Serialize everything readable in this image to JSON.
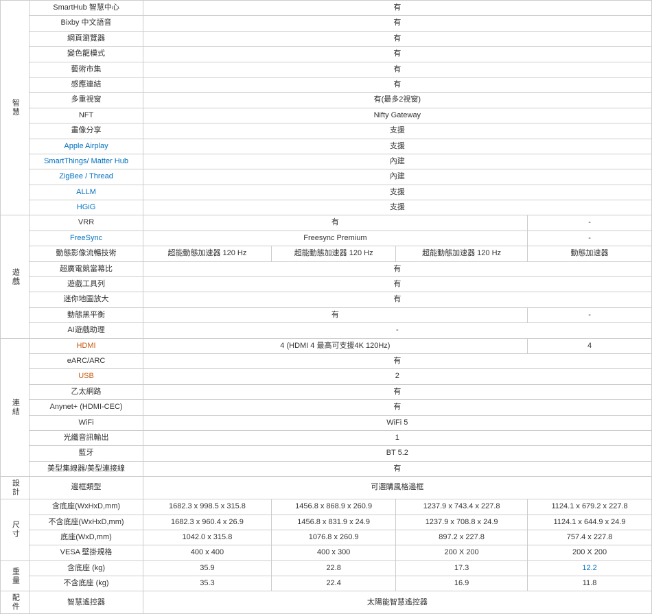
{
  "categories": {
    "smart": "智慧",
    "gaming": "遊戲",
    "connect": "連結",
    "design": "設計",
    "size": "尺寸",
    "weight": "重量",
    "accessory": "配件"
  },
  "rows": [
    {
      "cat": "智慧",
      "feature": "SmartHub 智慧中心",
      "values": [
        "有",
        "",
        "",
        ""
      ],
      "span": 4
    },
    {
      "cat": "",
      "feature": "Bixby 中文語音",
      "values": [
        "有",
        "",
        "",
        ""
      ],
      "span": 4
    },
    {
      "cat": "",
      "feature": "網頁瀏覽器",
      "values": [
        "有",
        "",
        "",
        ""
      ],
      "span": 4
    },
    {
      "cat": "",
      "feature": "變色龍模式",
      "values": [
        "有",
        "",
        "",
        ""
      ],
      "span": 4
    },
    {
      "cat": "",
      "feature": "藝術市集",
      "values": [
        "有",
        "",
        "",
        ""
      ],
      "span": 4
    },
    {
      "cat": "",
      "feature": "感應連結",
      "values": [
        "有",
        "",
        "",
        ""
      ],
      "span": 4
    },
    {
      "cat": "",
      "feature": "多重視窗",
      "values": [
        "有(最多2視窗)",
        "",
        "",
        ""
      ],
      "span": 4
    },
    {
      "cat": "",
      "feature": "NFT",
      "values": [
        "Nifty Gateway",
        "",
        "",
        ""
      ],
      "span": 4
    },
    {
      "cat": "",
      "feature": "畫像分享",
      "values": [
        "支援",
        "",
        "",
        ""
      ],
      "span": 4
    },
    {
      "cat": "",
      "feature": "Apple Airplay",
      "feature_color": "blue",
      "values": [
        "支援",
        "",
        "",
        ""
      ],
      "span": 4
    },
    {
      "cat": "",
      "feature": "SmartThings/ Matter Hub",
      "feature_color": "blue",
      "values": [
        "內建",
        "",
        "",
        ""
      ],
      "span": 4
    },
    {
      "cat": "",
      "feature": "ZigBee / Thread",
      "feature_color": "blue",
      "values": [
        "內建",
        "",
        "",
        ""
      ],
      "span": 4
    },
    {
      "cat": "",
      "feature": "ALLM",
      "feature_color": "blue",
      "values": [
        "支援",
        "",
        "",
        ""
      ],
      "span": 4
    },
    {
      "cat": "",
      "feature": "HGiG",
      "feature_color": "blue",
      "values": [
        "支援",
        "",
        "",
        ""
      ],
      "span": 4
    },
    {
      "cat": "遊戲",
      "feature": "VRR",
      "values": [
        "有",
        "",
        "",
        "-"
      ],
      "span_partial": true,
      "v1span": 3,
      "last": "-"
    },
    {
      "cat": "",
      "feature": "FreeSync",
      "feature_color": "blue",
      "values": [
        "Freesync Premium",
        "",
        "",
        "-"
      ],
      "span_partial": true,
      "v1span": 3,
      "last": "-"
    },
    {
      "cat": "",
      "feature": "動態影像流暢技術",
      "values": [
        "超能動態加速器 120 Hz",
        "超能動態加速器 120 Hz",
        "超能動態加速器 120 Hz",
        "動態加速器"
      ],
      "span": 0
    },
    {
      "cat": "",
      "feature": "超廣電競當幕比",
      "values": [
        "有",
        "",
        "",
        ""
      ],
      "span": 4
    },
    {
      "cat": "",
      "feature": "遊戲工具列",
      "values": [
        "有",
        "",
        "",
        ""
      ],
      "span": 4
    },
    {
      "cat": "",
      "feature": "迷你地圖放大",
      "values": [
        "有",
        "",
        "",
        ""
      ],
      "span": 4
    },
    {
      "cat": "",
      "feature": "動態黑平衡",
      "values": [
        "有",
        "",
        "",
        "-"
      ],
      "span_partial": true,
      "v1span": 3,
      "last": "-"
    },
    {
      "cat": "",
      "feature": "AI遊戲助理",
      "values": [
        "-",
        "",
        "",
        ""
      ],
      "span": 4
    },
    {
      "cat": "連結",
      "feature": "HDMI",
      "feature_color": "orange",
      "values": [
        "4 (HDMI 4 最高可支援4K 120Hz)",
        "",
        "",
        "4"
      ],
      "span_partial": true,
      "v1span": 3,
      "last": "4"
    },
    {
      "cat": "",
      "feature": "eARC/ARC",
      "values": [
        "有",
        "",
        "",
        ""
      ],
      "span": 4
    },
    {
      "cat": "",
      "feature": "USB",
      "feature_color": "orange",
      "values": [
        "2",
        "",
        "",
        ""
      ],
      "span": 4
    },
    {
      "cat": "",
      "feature": "乙太網路",
      "values": [
        "有",
        "",
        "",
        ""
      ],
      "span": 4
    },
    {
      "cat": "",
      "feature": "Anynet+ (HDMI-CEC)",
      "values": [
        "有",
        "",
        "",
        ""
      ],
      "span": 4
    },
    {
      "cat": "",
      "feature": "WiFi",
      "values": [
        "WiFi 5",
        "",
        "",
        ""
      ],
      "span": 4
    },
    {
      "cat": "",
      "feature": "光纖音訊輸出",
      "values": [
        "1",
        "",
        "",
        ""
      ],
      "span": 4
    },
    {
      "cat": "",
      "feature": "藍牙",
      "values": [
        "BT 5.2",
        "",
        "",
        ""
      ],
      "span": 4
    },
    {
      "cat": "",
      "feature": "美型集線器/美型連接線",
      "values": [
        "有",
        "",
        "",
        ""
      ],
      "span": 4
    },
    {
      "cat": "設計",
      "feature": "邊框類型",
      "values": [
        "可選購風格邊框",
        "",
        "",
        ""
      ],
      "span": 4
    },
    {
      "cat": "尺寸",
      "feature": "含底座(WxHxD,mm)",
      "values": [
        "1682.3 x 998.5 x 315.8",
        "1456.8 x 868.9 x 260.9",
        "1237.9 x 743.4 x 227.8",
        "1124.1 x 679.2 x 227.8"
      ],
      "span": 0
    },
    {
      "cat": "",
      "feature": "不含底座(WxHxD,mm)",
      "values": [
        "1682.3 x 960.4 x 26.9",
        "1456.8 x 831.9 x 24.9",
        "1237.9 x 708.8 x 24.9",
        "1124.1 x 644.9 x 24.9"
      ],
      "span": 0
    },
    {
      "cat": "",
      "feature": "底座(WxD,mm)",
      "values": [
        "1042.0 x 315.8",
        "1076.8 x 260.9",
        "897.2 x 227.8",
        "757.4 x 227.8"
      ],
      "span": 0
    },
    {
      "cat": "",
      "feature": "VESA 壁掛規格",
      "values": [
        "400 x 400",
        "400 x 300",
        "200 X 200",
        "200 X 200"
      ],
      "span": 0
    },
    {
      "cat": "重量",
      "feature": "含底座 (kg)",
      "values": [
        "35.9",
        "22.8",
        "17.3",
        "12.2"
      ],
      "span": 0,
      "last_color": "blue"
    },
    {
      "cat": "",
      "feature": "不含底座 (kg)",
      "values": [
        "35.3",
        "22.4",
        "16.9",
        "11.8"
      ],
      "span": 0
    },
    {
      "cat": "配件",
      "feature": "智慧遙控器",
      "values": [
        "太陽能智慧遙控器",
        "",
        "",
        ""
      ],
      "span": 4
    }
  ]
}
